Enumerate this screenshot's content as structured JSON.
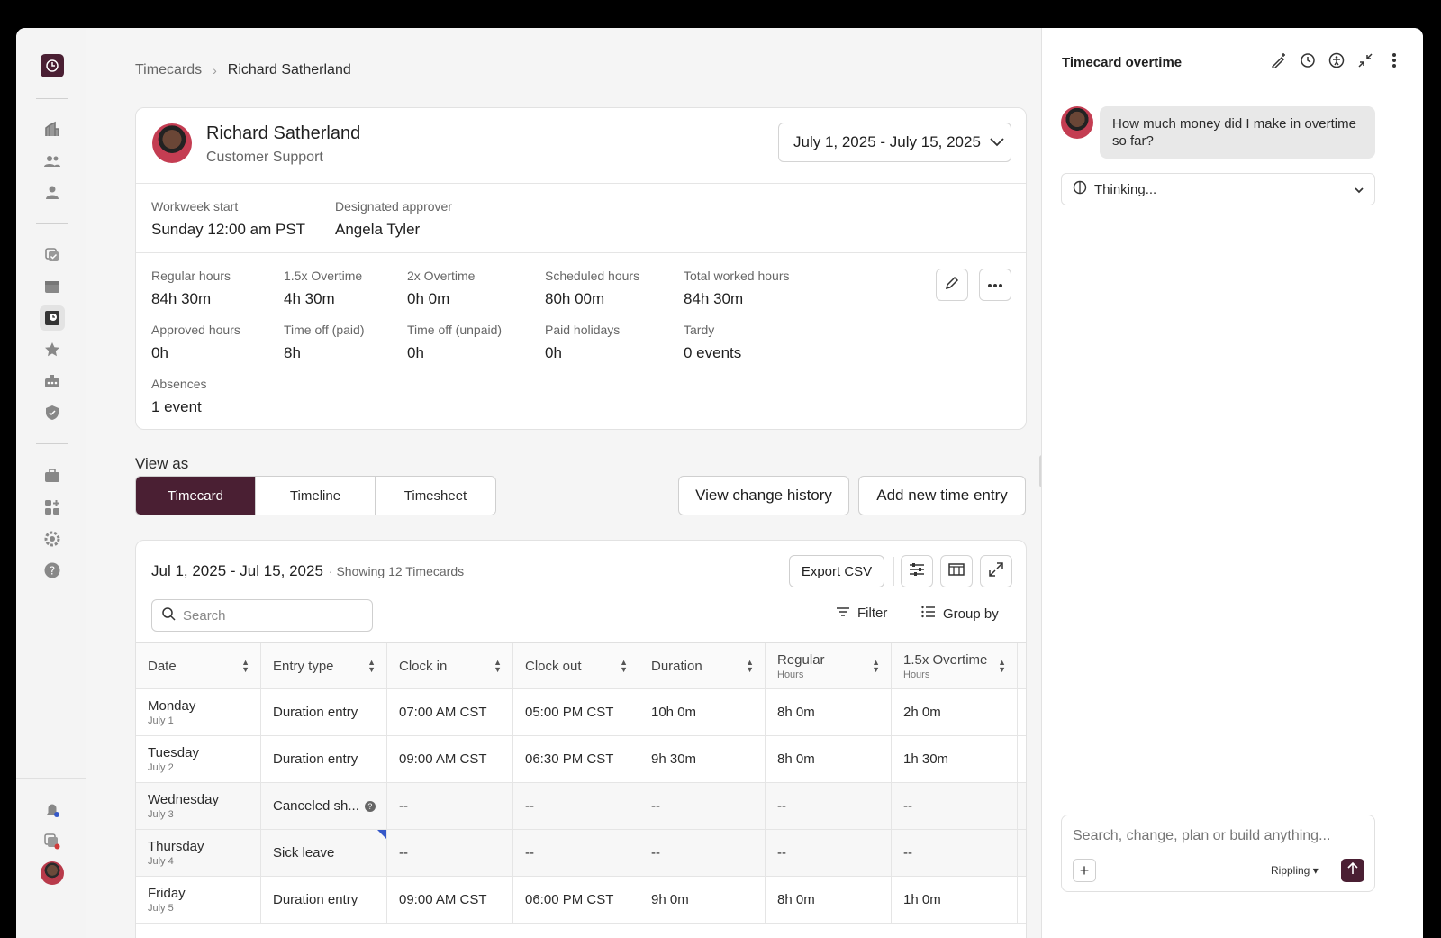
{
  "breadcrumb": {
    "parent": "Timecards",
    "current": "Richard Satherland"
  },
  "profile": {
    "name": "Richard Satherland",
    "department": "Customer Support",
    "date_range": "July 1, 2025 - July 15, 2025"
  },
  "meta": [
    {
      "label": "Workweek start",
      "value": "Sunday 12:00 am PST"
    },
    {
      "label": "Designated approver",
      "value": "Angela Tyler"
    }
  ],
  "stats": [
    {
      "label": "Regular hours",
      "value": "84h 30m"
    },
    {
      "label": "1.5x Overtime",
      "value": "4h 30m"
    },
    {
      "label": "2x Overtime",
      "value": "0h 0m"
    },
    {
      "label": "Scheduled hours",
      "value": "80h 00m"
    },
    {
      "label": "Total worked hours",
      "value": "84h 30m"
    },
    {
      "label": "Approved hours",
      "value": "0h"
    },
    {
      "label": "Time off (paid)",
      "value": "8h"
    },
    {
      "label": "Time off (unpaid)",
      "value": "0h"
    },
    {
      "label": "Paid holidays",
      "value": "0h"
    },
    {
      "label": "Tardy",
      "value": "0 events"
    },
    {
      "label": "Absences",
      "value": "1 event"
    }
  ],
  "view_as": {
    "label": "View as",
    "tabs": [
      "Timecard",
      "Timeline",
      "Timesheet"
    ],
    "selected": "Timecard"
  },
  "actions": {
    "history": "View change history",
    "add": "Add new time entry"
  },
  "table": {
    "range": "Jul 1, 2025 - Jul 15, 2025",
    "showing": "· Showing 12 Timecards",
    "export": "Export CSV",
    "search_placeholder": "Search",
    "filter": "Filter",
    "group_by": "Group by",
    "columns": [
      {
        "title": "Date",
        "sub": ""
      },
      {
        "title": "Entry type",
        "sub": ""
      },
      {
        "title": "Clock in",
        "sub": ""
      },
      {
        "title": "Clock out",
        "sub": ""
      },
      {
        "title": "Duration",
        "sub": ""
      },
      {
        "title": "Regular",
        "sub": "Hours"
      },
      {
        "title": "1.5x Overtime",
        "sub": "Hours"
      }
    ],
    "rows": [
      {
        "day": "Monday",
        "date": "July 1",
        "type": "Duration entry",
        "in": "07:00 AM CST",
        "out": "05:00 PM CST",
        "dur": "10h 0m",
        "reg": "8h 0m",
        "ot": "2h 0m"
      },
      {
        "day": "Tuesday",
        "date": "July 2",
        "type": "Duration entry",
        "in": "09:00 AM CST",
        "out": "06:30 PM CST",
        "dur": "9h 30m",
        "reg": "8h 0m",
        "ot": "1h 30m"
      },
      {
        "day": "Wednesday",
        "date": "July 3",
        "type": "Canceled sh...",
        "in": "--",
        "out": "--",
        "dur": "--",
        "reg": "--",
        "ot": "--"
      },
      {
        "day": "Thursday",
        "date": "July 4",
        "type": "Sick leave",
        "in": "--",
        "out": "--",
        "dur": "--",
        "reg": "--",
        "ot": "--"
      },
      {
        "day": "Friday",
        "date": "July 5",
        "type": "Duration entry",
        "in": "09:00 AM CST",
        "out": "06:00 PM CST",
        "dur": "9h 0m",
        "reg": "8h 0m",
        "ot": "1h 0m"
      }
    ]
  },
  "panel": {
    "title": "Timecard overtime",
    "user_message": "How much money did I make in overtime so far?",
    "status": "Thinking...",
    "composer_placeholder": "Search, change, plan or build anything...",
    "model": "Rippling"
  },
  "colors": {
    "brand": "#4a1f33",
    "background": "#f5f5f5"
  }
}
